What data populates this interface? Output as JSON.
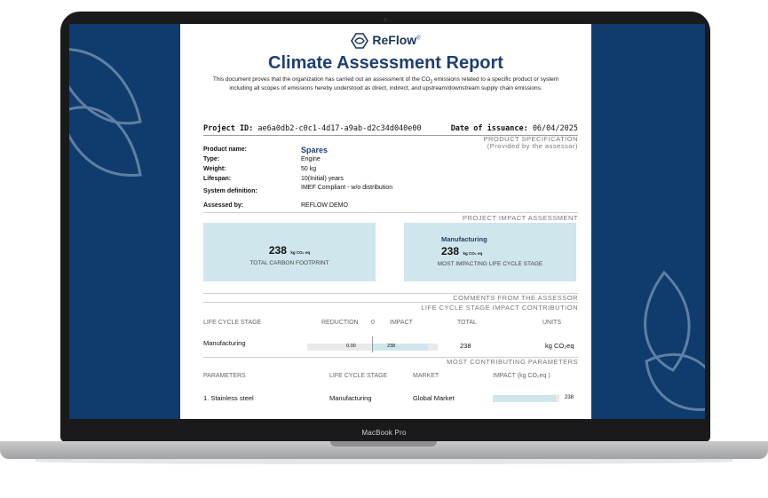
{
  "device": {
    "label": "MacBook Pro"
  },
  "brand": {
    "name": "ReFlow",
    "mark": "®",
    "logo_icon": "reflow-logo-icon"
  },
  "report": {
    "title": "Climate Assessment Report",
    "intro_pre": "This document proves that the organization has carried out an assessment of the CO",
    "intro_sub": "2",
    "intro_post": " emissions related to a specific product or system including all scopes of emissions hereby understood as direct, indirect, and upstream/downstream supply chain emissions.",
    "project_id_label": "Project ID:",
    "project_id": "ae6a0db2-c0c1-4d17-a9ab-d2c34d040e00",
    "date_label": "Date of issuance:",
    "date": "06/04/2025"
  },
  "product_spec": {
    "heading": "PRODUCT SPECIFICATION",
    "subheading": "(Provided by the assessor)",
    "product_name_label": "Product name:",
    "product_name": "Spares",
    "type_label": "Type:",
    "type": "Engine",
    "weight_label": "Weight:",
    "weight": "50 kg",
    "lifespan_label": "Lifespan:",
    "lifespan": "10(Initial) years",
    "system_label": "System definition:",
    "system": "IMEF Compliant - w/o distribution",
    "assessed_label": "Assessed by:",
    "assessed": "REFLOW DEMO"
  },
  "impact": {
    "heading": "PROJECT IMPACT ASSESSMENT",
    "total_value": "238",
    "total_unit": "kg CO₂ eq",
    "total_caption": "TOTAL CARBON FOOTPRINT",
    "top_stage": "Manufacturing",
    "top_value": "238",
    "top_unit": "kg CO₂ eq",
    "top_caption": "MOST IMPACTING LIFE CYCLE STAGE"
  },
  "comments": {
    "heading": "COMMENTS FROM THE ASSESSOR"
  },
  "lifecycle": {
    "heading": "LIFE CYCLE STAGE IMPACT CONTRIBUTION",
    "col_stage": "LIFE CYCLE STAGE",
    "col_reduction": "REDUCTION",
    "col_zero": "0",
    "col_impact": "IMPACT",
    "col_total": "TOTAL",
    "col_units": "UNITS",
    "rows": [
      {
        "stage": "Manufacturing",
        "reduction": "0.00",
        "impact": "238",
        "total": "238",
        "units": "kg CO₂eq",
        "impact_fraction": 1.0
      }
    ]
  },
  "parameters": {
    "heading": "MOST CONTRIBUTING PARAMETERS",
    "col_param": "PARAMETERS",
    "col_stage": "LIFE CYCLE STAGE",
    "col_market": "MARKET",
    "col_impact": "IMPACT (kg CO₂eq )",
    "rows": [
      {
        "param": "1. Stainless steel",
        "stage": "Manufacturing",
        "market": "Global Market",
        "impact": "238",
        "impact_fraction": 1.0
      }
    ]
  },
  "colors": {
    "screen_bg": "#0f3c6c",
    "accent": "#1d3f73",
    "card_bg": "#cfe6ec"
  }
}
